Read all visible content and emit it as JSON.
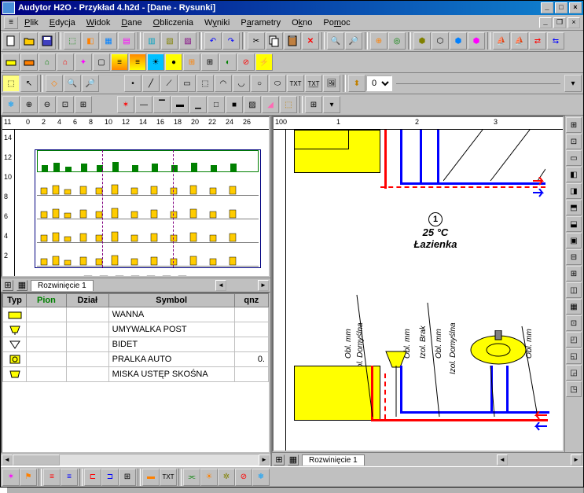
{
  "title": "Audytor H2O - Przykład 4.h2d - [Dane - Rysunki]",
  "menu": {
    "plik": "Plik",
    "edycja": "Edycja",
    "widok": "Widok",
    "dane": "Dane",
    "obliczenia": "Obliczenia",
    "wyniki": "Wyniki",
    "parametry": "Parametry",
    "okno": "Okno",
    "pomoc": "Pomoc"
  },
  "tabs": {
    "left": "Rozwinięcie 1",
    "right": "Rozwinięcie 1"
  },
  "layer_combo": "0",
  "ruler_left": {
    "start": 11,
    "ticks": [
      "0",
      "2",
      "4",
      "6",
      "8",
      "10",
      "12",
      "14",
      "16",
      "18",
      "20",
      "22",
      "24",
      "26"
    ],
    "vticks": [
      "14",
      "12",
      "10",
      "8",
      "6",
      "4",
      "2"
    ]
  },
  "ruler_right": {
    "start": 100,
    "ticks": [
      "1",
      "2",
      "3"
    ],
    "vticks": []
  },
  "room": {
    "number": "1",
    "temp": "25 °C",
    "name": "Łazienka"
  },
  "pipe_labels": [
    "Obl. mm",
    "Izol. Domyślna",
    "Obl. mm",
    "Izol. Brak",
    "Obl. mm",
    "Izol. Domyślna",
    "Obl. mm"
  ],
  "grid": {
    "headers": {
      "typ": "Typ",
      "pion": "Pion",
      "dzial": "Dział",
      "symbol": "Symbol",
      "qn": "qnz"
    },
    "rows": [
      {
        "symbol": "WANNA",
        "qn": ""
      },
      {
        "symbol": "UMYWALKA POST",
        "qn": ""
      },
      {
        "symbol": "BIDET",
        "qn": ""
      },
      {
        "symbol": "PRALKA AUTO",
        "qn": "0."
      },
      {
        "symbol": "MISKA USTĘP SKOŚNA",
        "qn": ""
      }
    ]
  }
}
